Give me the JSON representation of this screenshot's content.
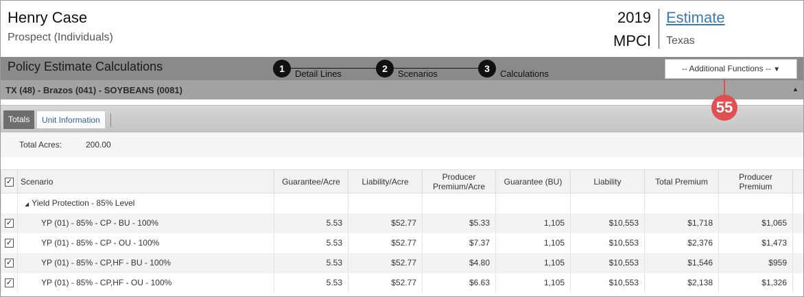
{
  "header": {
    "name": "Henry Case",
    "subtitle": "Prospect (Individuals)",
    "year": "2019",
    "program": "MPCI",
    "estimate_link": "Estimate",
    "state": "Texas"
  },
  "titlebar": {
    "title": "Policy Estimate Calculations",
    "steps": [
      {
        "num": "1",
        "label": "Detail Lines"
      },
      {
        "num": "2",
        "label": "Scenarios"
      },
      {
        "num": "3",
        "label": "Calculations"
      }
    ],
    "additional_functions": "-- Additional Functions --"
  },
  "section": {
    "title": "TX (48) - Brazos (041) - SOYBEANS (0081)"
  },
  "badge": "55",
  "tabs": [
    {
      "label": "Totals",
      "active": true
    },
    {
      "label": "Unit Information",
      "active": false
    }
  ],
  "acres": {
    "label": "Total Acres:",
    "value": "200.00"
  },
  "table": {
    "headers": [
      "Scenario",
      "Guarantee/Acre",
      "Liability/Acre",
      "Producer Premium/Acre",
      "Guarantee (BU)",
      "Liability",
      "Total Premium",
      "Producer Premium"
    ],
    "group": "Yield Protection - 85% Level",
    "rows": [
      [
        "YP (01) - 85% - CP - BU - 100%",
        "5.53",
        "$52.77",
        "$5.33",
        "1,105",
        "$10,553",
        "$1,718",
        "$1,065"
      ],
      [
        "YP (01) - 85% - CP - OU - 100%",
        "5.53",
        "$52.77",
        "$7.37",
        "1,105",
        "$10,553",
        "$2,376",
        "$1,473"
      ],
      [
        "YP (01) - 85% - CP,HF - BU - 100%",
        "5.53",
        "$52.77",
        "$4.80",
        "1,105",
        "$10,553",
        "$1,546",
        "$959"
      ],
      [
        "YP (01) - 85% - CP,HF - OU - 100%",
        "5.53",
        "$52.77",
        "$6.63",
        "1,105",
        "$10,553",
        "$2,138",
        "$1,326"
      ]
    ]
  },
  "colors": {
    "link": "#3a78b8",
    "badge": "#e05050",
    "titlebar": "#8a8a8a",
    "section": "#a3a3a3"
  },
  "icons": {
    "check": "checkmark-icon",
    "dropdown": "triangle-down-icon",
    "collapse": "triangle-up-icon",
    "group_toggle": "triangle-down-small-icon"
  }
}
